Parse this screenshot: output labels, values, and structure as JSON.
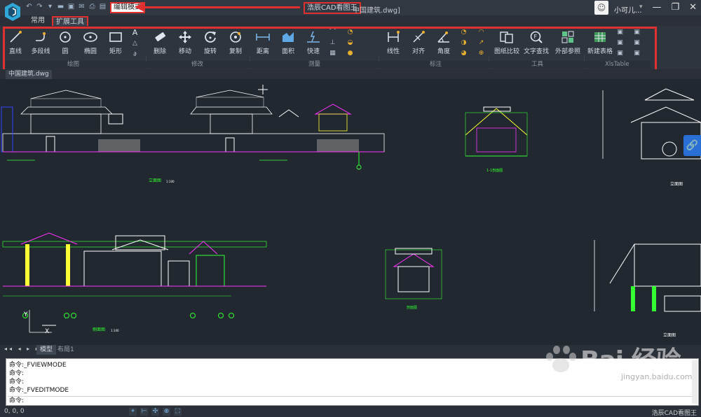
{
  "titlebar": {
    "edit_mode_label": "编辑模式",
    "app_title": "浩辰CAD看图王",
    "file_title": "中国建筑.dwg]",
    "user_name": "小可儿...",
    "user_caret": "▾",
    "minimize": "—",
    "restore": "❐",
    "close": "✕"
  },
  "tabs": {
    "common": "常用",
    "extend": "扩展工具"
  },
  "ribbon": {
    "draw": {
      "label": "绘图",
      "line": "直线",
      "polyline": "多段线",
      "circle": "圆",
      "ellipse": "椭圆",
      "rect": "矩形",
      "text_a": "A"
    },
    "modify": {
      "label": "修改",
      "delete": "删除",
      "move": "移动",
      "rotate": "旋转",
      "copy": "复制"
    },
    "measure": {
      "label": "测量",
      "distance": "距离",
      "area": "面积",
      "quick": "快速"
    },
    "annotate": {
      "label": "标注",
      "linear": "线性",
      "align": "对齐",
      "angle": "角度"
    },
    "tools": {
      "label": "工具",
      "compare": "图纸比较",
      "find_text": "文字查找",
      "xref": "外部参照"
    },
    "xlstable": {
      "label": "XlsTable",
      "new_table": "新建表格"
    }
  },
  "document_tab": "中国建筑.dwg",
  "drawing_labels": {
    "elev_1": "立面图",
    "elev_2": "立面图",
    "side_elev": "侧面图",
    "elev_3": "立面图",
    "small_1": "1-1剖面图",
    "small_2": "剖面图",
    "scale": "1:100",
    "axis_x": "X",
    "axis_y": "Y"
  },
  "layout_tabs": {
    "nav": "◂◂ ◂ ▸ ▸▸",
    "model": "模型",
    "layout1": "布局1"
  },
  "command_history": [
    "命令:_FVIEWMODE",
    "命令:",
    "命令:",
    "命令:_FVEDITMODE",
    "命令:"
  ],
  "status": {
    "coords": "0, 0, 0",
    "brand": "浩辰CAD看图王"
  },
  "watermark": {
    "text": "Bai 经验",
    "sub": "jingyan.baidu.com"
  },
  "colors": {
    "red_highlight": "#e03030",
    "canvas_bg": "#212830",
    "accent_blue": "#2a6fd6"
  }
}
